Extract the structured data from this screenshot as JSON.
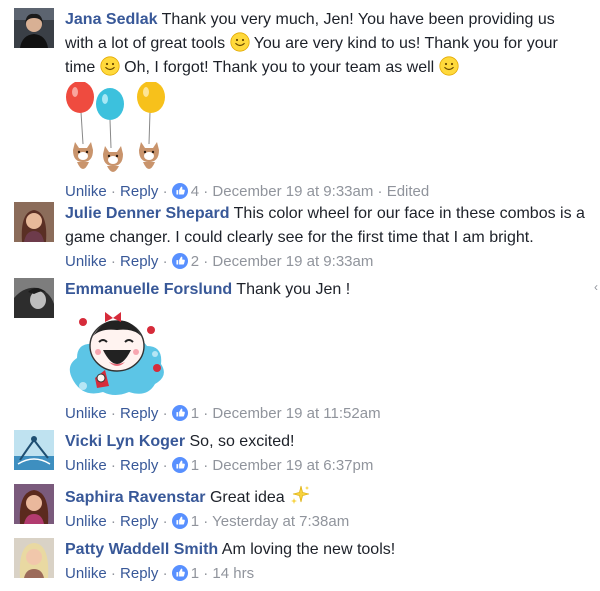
{
  "comments": [
    {
      "author": "Jana Sedlak",
      "text_parts": [
        "Thank you very much, Jen! You have been providing us with a lot of great tools",
        "You are very kind to us! Thank you for your time",
        "Oh, I forgot! Thank you to your team as well"
      ],
      "sticker": "balloon-cats-sticker",
      "actions": {
        "unlike": "Unlike",
        "reply": "Reply",
        "likes": "4",
        "time": "December 19 at 9:33am",
        "edited": "Edited"
      }
    },
    {
      "author": "Julie Denner Shepard",
      "text": "This color wheel for our face in these combos is a game changer. I could clearly see for the first time that I am bright.",
      "actions": {
        "unlike": "Unlike",
        "reply": "Reply",
        "likes": "2",
        "time": "December 19 at 9:33am"
      }
    },
    {
      "author": "Emmanuelle Forslund",
      "text": "Thank you Jen !",
      "sticker": "laughing-girl-sticker",
      "actions": {
        "unlike": "Unlike",
        "reply": "Reply",
        "likes": "1",
        "time": "December 19 at 11:52am"
      }
    },
    {
      "author": "Vicki Lyn Koger",
      "text": "So, so excited!",
      "actions": {
        "unlike": "Unlike",
        "reply": "Reply",
        "likes": "1",
        "time": "December 19 at 6:37pm"
      }
    },
    {
      "author": "Saphira Ravenstar",
      "text": "Great idea",
      "emoji": "sparkles-icon",
      "actions": {
        "unlike": "Unlike",
        "reply": "Reply",
        "likes": "1",
        "time": "Yesterday at 7:38am"
      }
    },
    {
      "author": "Patty Waddell Smith",
      "text": "Am loving the new tools!",
      "actions": {
        "unlike": "Unlike",
        "reply": "Reply",
        "likes": "1",
        "time": "14 hrs"
      }
    }
  ],
  "separator": "·",
  "colors": {
    "name": "#385898",
    "link": "#385898",
    "meta": "#90949c",
    "like": "#4267b2"
  }
}
